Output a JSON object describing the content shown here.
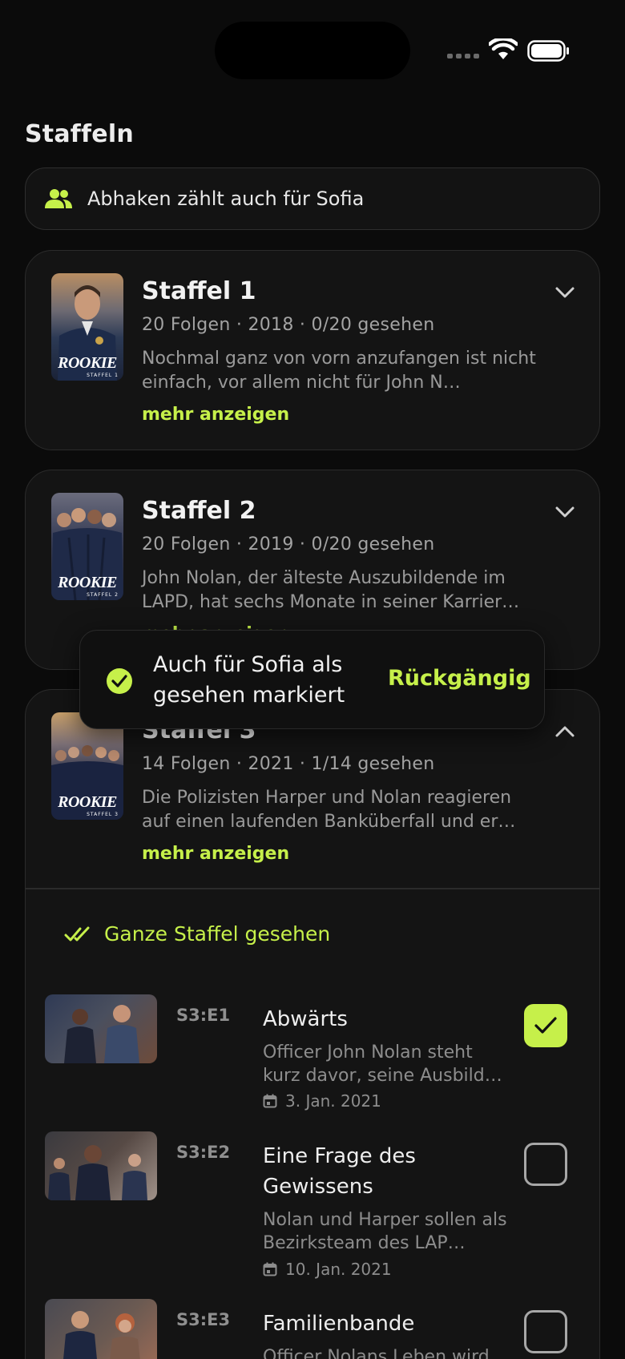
{
  "section_title": "Staffeln",
  "shared_banner": {
    "text": "Abhaken zählt auch für Sofia"
  },
  "seasons": [
    {
      "title": "Staffel 1",
      "meta": "20 Folgen · 2018 · 0/20 gesehen",
      "description": "Nochmal ganz von vorn anzufangen ist nicht einfach, vor allem nicht für John N…",
      "more_label": "mehr anzeigen",
      "poster_brand": "ROOKIE",
      "poster_sub": "STAFFEL 1",
      "expanded": false
    },
    {
      "title": "Staffel 2",
      "meta": "20 Folgen · 2019 · 0/20 gesehen",
      "description": "John Nolan, der älteste Auszubildende im LAPD, hat sechs Monate in seiner Karrier…",
      "more_label": "mehr anzeigen",
      "poster_brand": "ROOKIE",
      "poster_sub": "STAFFEL 2",
      "expanded": false
    },
    {
      "title": "Staffel 3",
      "meta": "14 Folgen · 2021 · 1/14 gesehen",
      "description": "Die Polizisten Harper und Nolan reagieren auf einen laufenden Banküberfall und er…",
      "more_label": "mehr anzeigen",
      "poster_brand": "ROOKIE",
      "poster_sub": "STAFFEL 3",
      "expanded": true,
      "mark_all_label": "Ganze Staffel gesehen",
      "episodes": [
        {
          "code": "S3:E1",
          "title": "Abwärts",
          "description": "Officer John Nolan steht kurz davor, seine Ausbild…",
          "date": "3. Jan. 2021",
          "watched": true
        },
        {
          "code": "S3:E2",
          "title": "Eine Frage des Gewissens",
          "description": "Nolan und Harper sollen als Bezirksteam des LAP…",
          "date": "10. Jan. 2021",
          "watched": false
        },
        {
          "code": "S3:E3",
          "title": "Familienbande",
          "description": "Officer Nolans Leben wird",
          "date": "",
          "watched": false
        }
      ]
    }
  ],
  "toast": {
    "message": "Auch für Sofia als gesehen markiert",
    "action": "Rückgängig"
  },
  "colors": {
    "accent": "#c6f04a",
    "background": "#0b0b0b",
    "card": "#141414"
  }
}
